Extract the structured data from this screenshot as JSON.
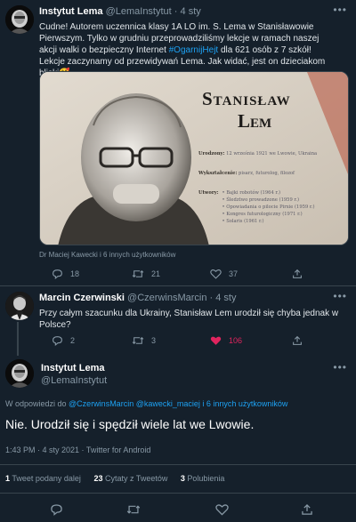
{
  "tweet1": {
    "display_name": "Instytut Lema",
    "handle": "@LemaInstytut",
    "time": "· 4 sty",
    "text_parts": [
      "Cudne! Autorem uczennica klasy 1A LO im. S. Lema w Stanisławowie Pierwszym. Tylko w grudniu przeprowadziliśmy lekcje w ramach naszej akcji walki o bezpieczny Internet ",
      "#OgarnijHejt",
      " dla 621 osób z 7 szkół! Lekcje zaczynamy od przewidywań Lema. Jak widać, jest on dzieciakom bliski",
      "🥰"
    ],
    "photo_text": {
      "title1": "Stanisław",
      "title2": "Lem",
      "born_label": "Urodzony:",
      "born_value": "12 września 1921 we Lwowie, Ukraina",
      "profession_label": "Wykształcenie:",
      "profession_value": "pisarz, futurolog, filozof",
      "works_label": "Utwory:",
      "works": [
        "• Bajki robotów (1964 r.)",
        "• Śledztwo prowadzone (1959 r.)",
        "• Opowiadania o pilocie Pirxie (1959 r.)",
        "• Kongres futurologiczny (1971 r.)",
        "• Solaris (1961 r.)"
      ]
    },
    "photo_credit": "Dr Maciej Kawecki i 6 innych użytkowników",
    "replies": "18",
    "retweets": "21",
    "likes": "37"
  },
  "tweet2": {
    "display_name": "Marcin Czerwinski",
    "handle": "@CzerwinsMarcin",
    "time": "· 4 sty",
    "text": "Przy całym szacunku dla Ukrainy, Stanisław Lem urodził się chyba jednak w Polsce?",
    "replies": "2",
    "retweets": "3",
    "likes": "106"
  },
  "tweet3": {
    "display_name": "Instytut Lema",
    "handle": "@LemaInstytut",
    "reply_prefix": "W odpowiedzi do ",
    "reply_to": "@CzerwinsMarcin @kawecki_maciej",
    "reply_others": " i 6 innych użytkowników",
    "text": "Nie. Urodził się i spędził wiele lat we Lwowie.",
    "meta": "1:43 PM · 4 sty 2021 · Twitter for Android",
    "retweet_count": "1",
    "retweet_label": "Tweet podany dalej",
    "quote_count": "23",
    "quote_label": "Cytaty z Tweetów",
    "like_count": "3",
    "like_label": "Polubienia"
  },
  "colors": {
    "background": "#15202b",
    "link": "#1da1f2",
    "like": "#e0245e",
    "muted": "#8899a6"
  },
  "icons": {
    "reply": "reply-icon",
    "retweet": "retweet-icon",
    "like": "heart-icon",
    "share": "share-icon",
    "more": "more-icon"
  }
}
